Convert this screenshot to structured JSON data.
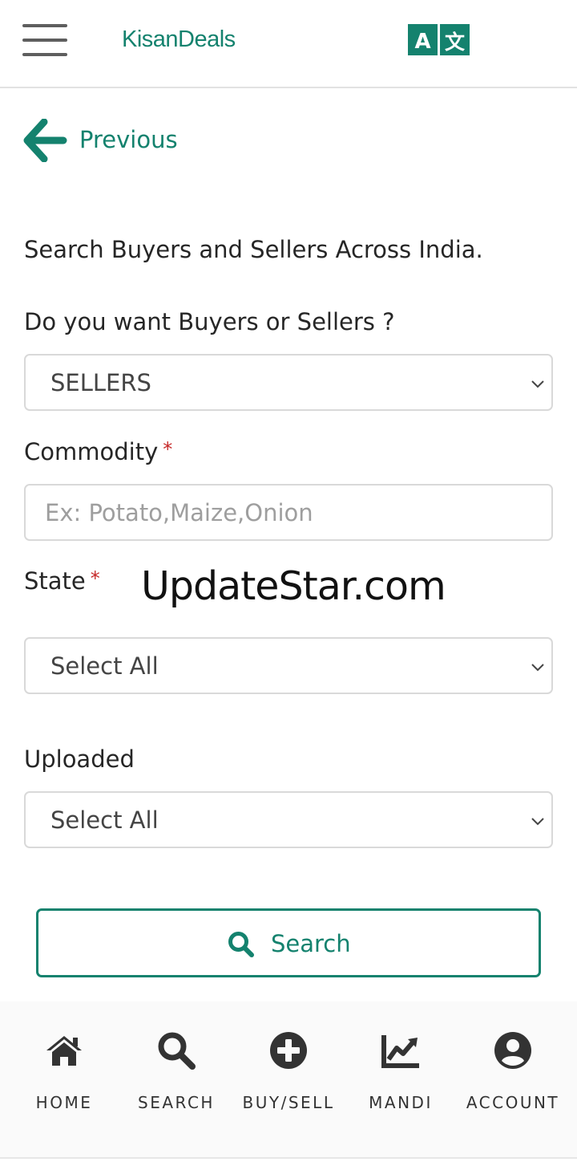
{
  "header": {
    "brand": "KisanDeals",
    "menu_icon": "hamburger-menu-icon",
    "translate_icon": "translate-icon",
    "translate_glyph_a": "A",
    "translate_glyph_b": "文"
  },
  "nav_back": {
    "label": "Previous",
    "icon": "arrow-left-icon"
  },
  "intro_text": "Search Buyers and Sellers Across India.",
  "form": {
    "type_label": "Do you want Buyers or Sellers ?",
    "type_value": "SELLERS",
    "commodity_label": "Commodity",
    "required_mark": "*",
    "commodity_placeholder": "Ex: Potato,Maize,Onion",
    "state_label": "State",
    "state_value": "Select All",
    "uploaded_label": "Uploaded",
    "uploaded_value": "Select All",
    "search_button": "Search"
  },
  "watermark": "UpdateStar.com",
  "bottom_nav": [
    {
      "label": "HOME",
      "icon": "home-icon"
    },
    {
      "label": "SEARCH",
      "icon": "search-icon"
    },
    {
      "label": "BUY/SELL",
      "icon": "plus-circle-icon"
    },
    {
      "label": "MANDI",
      "icon": "chart-line-icon"
    },
    {
      "label": "ACCOUNT",
      "icon": "user-circle-icon"
    }
  ],
  "colors": {
    "accent": "#14826e",
    "required": "#c62828",
    "icon_dark": "#333333",
    "border": "#d9d9d9"
  }
}
